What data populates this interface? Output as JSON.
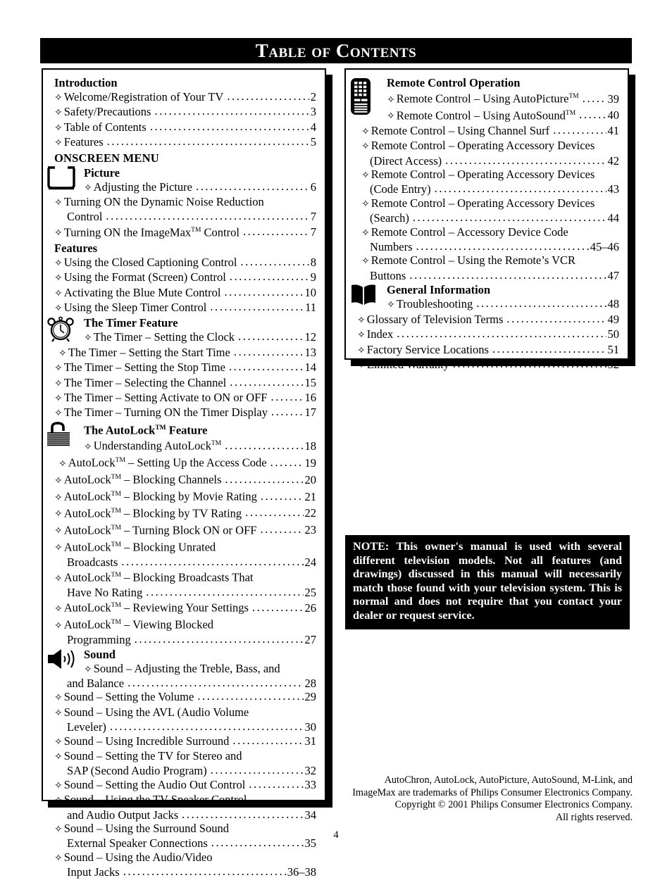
{
  "page": {
    "title": "Table of Contents",
    "page_number": "4"
  },
  "left_column": {
    "sections": [
      {
        "heading": "Introduction",
        "heading_style": "bold",
        "rows": [
          {
            "bullet": "✧",
            "label": "Welcome/Registration of Your TV",
            "page": "2"
          },
          {
            "bullet": "✧",
            "label": "Safety/Precautions",
            "page": "3"
          },
          {
            "bullet": "✧",
            "label": "Table of Contents",
            "page": "4"
          },
          {
            "bullet": "✧",
            "label": "Features",
            "page": "5"
          }
        ]
      },
      {
        "heading": "ONSCREEN MENU",
        "heading_style": "bold-caps",
        "rows": []
      },
      {
        "icon": "tv-screen-icon",
        "heading": "Picture",
        "heading_style": "bold-icon",
        "rows": [
          {
            "bullet": "✧",
            "label": "Adjusting the Picture",
            "page": "6",
            "indent": "icon"
          },
          {
            "bullet": "✧",
            "label": "Turning ON the Dynamic Noise Reduction",
            "page": "",
            "wrap": true
          },
          {
            "bullet": "",
            "label": "Control",
            "page": "7",
            "indent": "cont"
          },
          {
            "bullet": "✧",
            "label": "Turning ON the ImageMax™ Control",
            "page": "7"
          }
        ]
      },
      {
        "heading": "Features",
        "heading_style": "bold",
        "rows": [
          {
            "bullet": "✧",
            "label": "Using the Closed Captioning Control",
            "page": "8"
          },
          {
            "bullet": "✧",
            "label": "Using the Format (Screen) Control",
            "page": "9"
          },
          {
            "bullet": "✧",
            "label": "Activating the Blue Mute Control",
            "page": "10"
          },
          {
            "bullet": "✧",
            "label": "Using the Sleep Timer Control",
            "page": "11"
          }
        ]
      },
      {
        "icon": "alarm-clock-icon",
        "heading": "The Timer Feature",
        "heading_style": "bold-icon",
        "rows": [
          {
            "bullet": "✧",
            "label": "The Timer – Setting the Clock",
            "page": "12",
            "indent": "icon"
          },
          {
            "bullet": "✧",
            "label": "The Timer – Setting the Start Time",
            "page": "13",
            "indent": "gap"
          },
          {
            "bullet": "✧",
            "label": "The Timer – Setting the Stop Time",
            "page": "14"
          },
          {
            "bullet": "✧",
            "label": "The Timer – Selecting the Channel",
            "page": "15"
          },
          {
            "bullet": "✧",
            "label": "The Timer – Setting Activate to ON or OFF",
            "page": "16"
          },
          {
            "bullet": "✧",
            "label": "The Timer – Turning ON the Timer Display",
            "page": "17"
          }
        ]
      },
      {
        "icon": "padlock-icon",
        "heading": "The AutoLock™ Feature",
        "heading_style": "bold-icon",
        "rows": [
          {
            "bullet": "✧",
            "label": "Understanding AutoLock™",
            "page": "18",
            "indent": "icon"
          },
          {
            "bullet": "✧",
            "label": "AutoLock™ – Setting Up the Access Code",
            "page": "19",
            "indent": "gap"
          },
          {
            "bullet": "✧",
            "label": "AutoLock™ – Blocking Channels",
            "page": "20"
          },
          {
            "bullet": "✧",
            "label": "AutoLock™ – Blocking by Movie Rating",
            "page": "21"
          },
          {
            "bullet": "✧",
            "label": "AutoLock™ – Blocking by TV Rating",
            "page": "22"
          },
          {
            "bullet": "✧",
            "label": "AutoLock™ – Turning Block ON or OFF",
            "page": "23"
          },
          {
            "bullet": "✧",
            "label": "AutoLock™ – Blocking Unrated",
            "page": "",
            "wrap": true
          },
          {
            "bullet": "",
            "label": "Broadcasts",
            "page": "24",
            "indent": "cont"
          },
          {
            "bullet": "✧",
            "label": "AutoLock™ – Blocking Broadcasts That",
            "page": "",
            "wrap": true
          },
          {
            "bullet": "",
            "label": "Have No Rating",
            "page": "25",
            "indent": "cont"
          },
          {
            "bullet": "✧",
            "label": "AutoLock™ – Reviewing Your Settings",
            "page": "26"
          },
          {
            "bullet": "✧",
            "label": "AutoLock™ – Viewing Blocked",
            "page": "",
            "wrap": true
          },
          {
            "bullet": "",
            "label": "Programming",
            "page": "27",
            "indent": "cont"
          }
        ]
      },
      {
        "icon": "speaker-icon",
        "heading": "Sound",
        "heading_style": "bold-icon",
        "rows": [
          {
            "bullet": "✧",
            "label": "Sound – Adjusting the Treble, Bass, and",
            "page": "",
            "indent": "icon",
            "wrap": true
          },
          {
            "bullet": "",
            "label": "and Balance",
            "page": "28",
            "indent": "cont"
          },
          {
            "bullet": "✧",
            "label": "Sound – Setting the Volume",
            "page": "29"
          },
          {
            "bullet": "✧",
            "label": "Sound – Using the AVL (Audio Volume",
            "page": "",
            "wrap": true
          },
          {
            "bullet": "",
            "label": "Leveler)",
            "page": "30",
            "indent": "cont"
          },
          {
            "bullet": "✧",
            "label": "Sound – Using Incredible Surround",
            "page": "31"
          },
          {
            "bullet": "✧",
            "label": "Sound – Setting the TV for Stereo and",
            "page": "",
            "wrap": true
          },
          {
            "bullet": "",
            "label": "SAP (Second Audio Program)",
            "page": "32",
            "indent": "cont"
          },
          {
            "bullet": "✧",
            "label": "Sound – Setting the Audio Out Control",
            "page": "33"
          },
          {
            "bullet": "✧",
            "label": "Sound – Using the TV Speaker Control",
            "page": "",
            "wrap": true
          },
          {
            "bullet": "",
            "label": "and Audio Output Jacks",
            "page": "34",
            "indent": "cont"
          },
          {
            "bullet": "✧",
            "label": "Sound – Using the Surround Sound",
            "page": "",
            "wrap": true
          },
          {
            "bullet": "",
            "label": "External Speaker Connections",
            "page": "35",
            "indent": "cont"
          },
          {
            "bullet": "✧",
            "label": "Sound – Using the Audio/Video",
            "page": "",
            "wrap": true
          },
          {
            "bullet": "",
            "label": "Input Jacks",
            "page": "36–38",
            "indent": "cont"
          }
        ]
      }
    ]
  },
  "right_column": {
    "sections": [
      {
        "icon": "remote-control-icon",
        "heading": "Remote Control Operation",
        "heading_style": "bold-icon",
        "rows": [
          {
            "bullet": "✧",
            "label": "Remote Control – Using AutoPicture™",
            "page": "39",
            "indent": "icon"
          },
          {
            "bullet": "✧",
            "label": "Remote Control – Using AutoSound™",
            "page": "40",
            "indent": "icon"
          },
          {
            "bullet": "✧",
            "label": "Remote Control – Using Channel Surf",
            "page": "41",
            "indent": "gap"
          },
          {
            "bullet": "✧",
            "label": "Remote Control – Operating Accessory Devices",
            "page": "",
            "indent": "gap",
            "wrap": true
          },
          {
            "bullet": "",
            "label": "(Direct Access)",
            "page": "42",
            "indent": "cont"
          },
          {
            "bullet": "✧",
            "label": "Remote Control – Operating Accessory Devices",
            "page": "",
            "indent": "gap",
            "wrap": true
          },
          {
            "bullet": "",
            "label": "(Code Entry)",
            "page": "43",
            "indent": "cont"
          },
          {
            "bullet": "✧",
            "label": "Remote Control – Operating Accessory Devices",
            "page": "",
            "indent": "gap",
            "wrap": true
          },
          {
            "bullet": "",
            "label": "(Search)",
            "page": "44",
            "indent": "cont"
          },
          {
            "bullet": "✧",
            "label": "Remote Control – Accessory Device Code",
            "page": "",
            "indent": "gap",
            "wrap": true
          },
          {
            "bullet": "",
            "label": "Numbers",
            "page": "45–46",
            "indent": "cont"
          },
          {
            "bullet": "✧",
            "label": "Remote Control – Using the Remote’s VCR",
            "page": "",
            "indent": "gap",
            "wrap": true
          },
          {
            "bullet": "",
            "label": "Buttons",
            "page": "47",
            "indent": "cont"
          }
        ]
      },
      {
        "icon": "open-book-icon",
        "heading": "General Information",
        "heading_style": "bold-icon",
        "rows": [
          {
            "bullet": "✧",
            "label": "Troubleshooting",
            "page": "48",
            "indent": "icon"
          },
          {
            "bullet": "✧",
            "label": "Glossary of Television Terms",
            "page": "49"
          },
          {
            "bullet": "✧",
            "label": "Index",
            "page": "50"
          },
          {
            "bullet": "✧",
            "label": "Factory Service Locations",
            "page": "51"
          },
          {
            "bullet": "✧",
            "label": "Limited Warranty",
            "page": "52"
          }
        ]
      }
    ]
  },
  "note_box": {
    "text": "NOTE: This owner's manual is used with several different television models.  Not all features (and  drawings) discussed in this manual will necessarily match those found with your television system. This is normal and does not require that you contact your dealer or request service."
  },
  "footer": {
    "lines": [
      "AutoChron, AutoLock, AutoPicture, AutoSound, M-Link, and",
      "ImageMax are trademarks of Philips Consumer Electronics Company.",
      "Copyright © 2001 Philips Consumer Electronics Company.",
      "All rights reserved."
    ]
  },
  "colors": {
    "ink": "#000000",
    "paper": "#ffffff"
  }
}
